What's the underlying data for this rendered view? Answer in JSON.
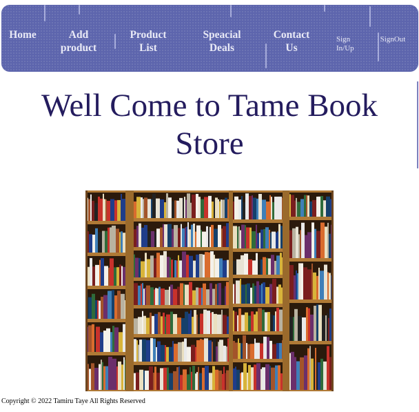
{
  "nav": {
    "home": [
      "Home"
    ],
    "add_product": [
      "Add",
      "product"
    ],
    "product_list": [
      "Product",
      "List"
    ],
    "special_deals": [
      "Speacial",
      "Deals"
    ],
    "contact_us": [
      "Contact",
      "Us"
    ],
    "sign_in_up": [
      "Sign",
      "In/Up"
    ],
    "sign_out": [
      "SignOut"
    ]
  },
  "page": {
    "title_line1": "Well Come to Tame Book",
    "title_line2": "Store"
  },
  "hero_image": {
    "subject": "bookstore bookshelves"
  },
  "footer": {
    "copyright": "Copyright © 2022 Tamiru Taye All Rights Reserved"
  },
  "colors": {
    "nav_background": "#5d65ad",
    "nav_text": "#e9eaf6",
    "title_text": "#241c5e"
  }
}
